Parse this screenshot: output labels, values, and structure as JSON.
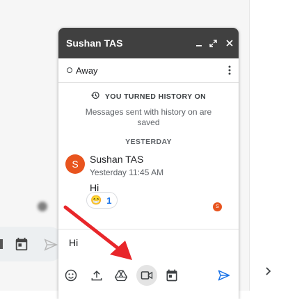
{
  "chat": {
    "title": "Sushan TAS",
    "status": "Away",
    "history_title": "YOU TURNED HISTORY ON",
    "history_subtitle": "Messages sent with history on are saved",
    "day_label": "YESTERDAY",
    "message": {
      "avatar_letter": "S",
      "sender": "Sushan TAS",
      "timestamp": "Yesterday 11:45 AM",
      "text": "Hi",
      "reaction_emoji": "😁",
      "reaction_count": "1"
    },
    "read_receipt_letter": "S",
    "compose_text": "Hi"
  },
  "colors": {
    "header_bg": "#404040",
    "avatar": "#e8541e",
    "send_blue": "#1a73e8",
    "arrow_red": "#e8262a"
  },
  "icons": [
    "minimize-icon",
    "pop-out-icon",
    "close-icon",
    "more-vert-icon",
    "history-icon",
    "emoji-icon",
    "upload-icon",
    "drive-icon",
    "video-call-icon",
    "calendar-icon",
    "send-icon",
    "chevron-right-icon"
  ]
}
